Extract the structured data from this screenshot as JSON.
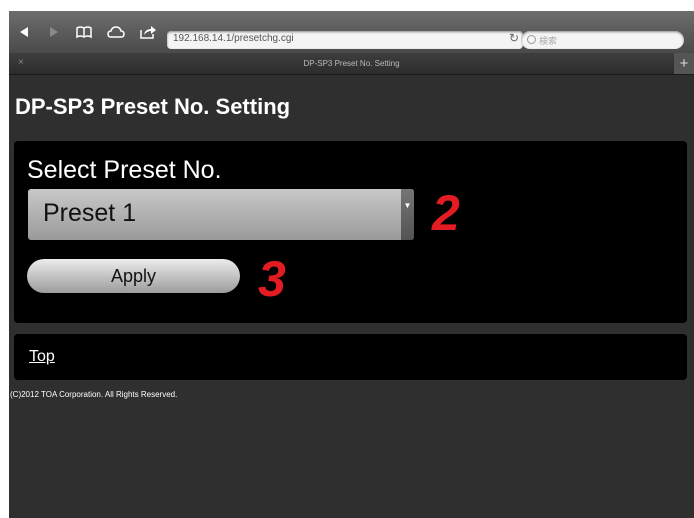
{
  "browser": {
    "url": "192.168.14.1/presetchg.cgi",
    "search_placeholder": "検索",
    "tab_title": "DP-SP3 Preset No. Setting",
    "tab_close": "×",
    "tab_add": "+"
  },
  "page": {
    "title": "DP-SP3 Preset No. Setting",
    "select_label": "Select Preset No.",
    "selected_preset": "Preset 1",
    "apply_label": "Apply",
    "top_link": "Top",
    "copyright": "(C)2012 TOA Corporation. All Rights Reserved."
  },
  "callouts": {
    "select_marker": "2",
    "apply_marker": "3"
  },
  "colors": {
    "callout": "#e21c22",
    "background": "#2f2f2f",
    "panel": "#000000"
  },
  "icons": [
    "back-icon",
    "forward-icon",
    "bookmarks-icon",
    "cloud-icon",
    "share-icon",
    "reload-icon",
    "search-icon",
    "close-icon",
    "plus-icon",
    "chevron-down-icon"
  ]
}
